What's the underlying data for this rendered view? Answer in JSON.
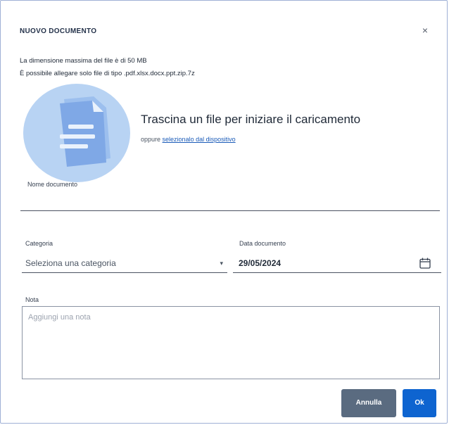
{
  "modal": {
    "title": "NUOVO DOCUMENTO",
    "close_label": "×"
  },
  "info": {
    "max_size": "La dimensione massima del file è di 50 MB",
    "allowed_types": "È possibile allegare solo file di tipo .pdf.xlsx.docx.ppt.zip.7z"
  },
  "dropzone": {
    "title": "Trascina un file per iniziare il caricamento",
    "or_text": "oppure",
    "link": "selezionalo dal dispositivo",
    "icon": "document-icon"
  },
  "name_field": {
    "label": "Nome documento"
  },
  "category": {
    "label": "Categoria",
    "value": "Seleziona una categoria",
    "caret": "▾"
  },
  "date": {
    "label": "Data documento",
    "value": "29/05/2024",
    "icon": "calendar-icon"
  },
  "note": {
    "label": "Nota",
    "placeholder": "Aggiungi una nota"
  },
  "buttons": {
    "cancel": "Annulla",
    "ok": "Ok"
  },
  "colors": {
    "primary": "#0e64d0",
    "secondary": "#5a6b80",
    "link": "#1a5bb8",
    "doc_circle": "#b8d3f3",
    "doc_paper": "#7fa8e6"
  }
}
